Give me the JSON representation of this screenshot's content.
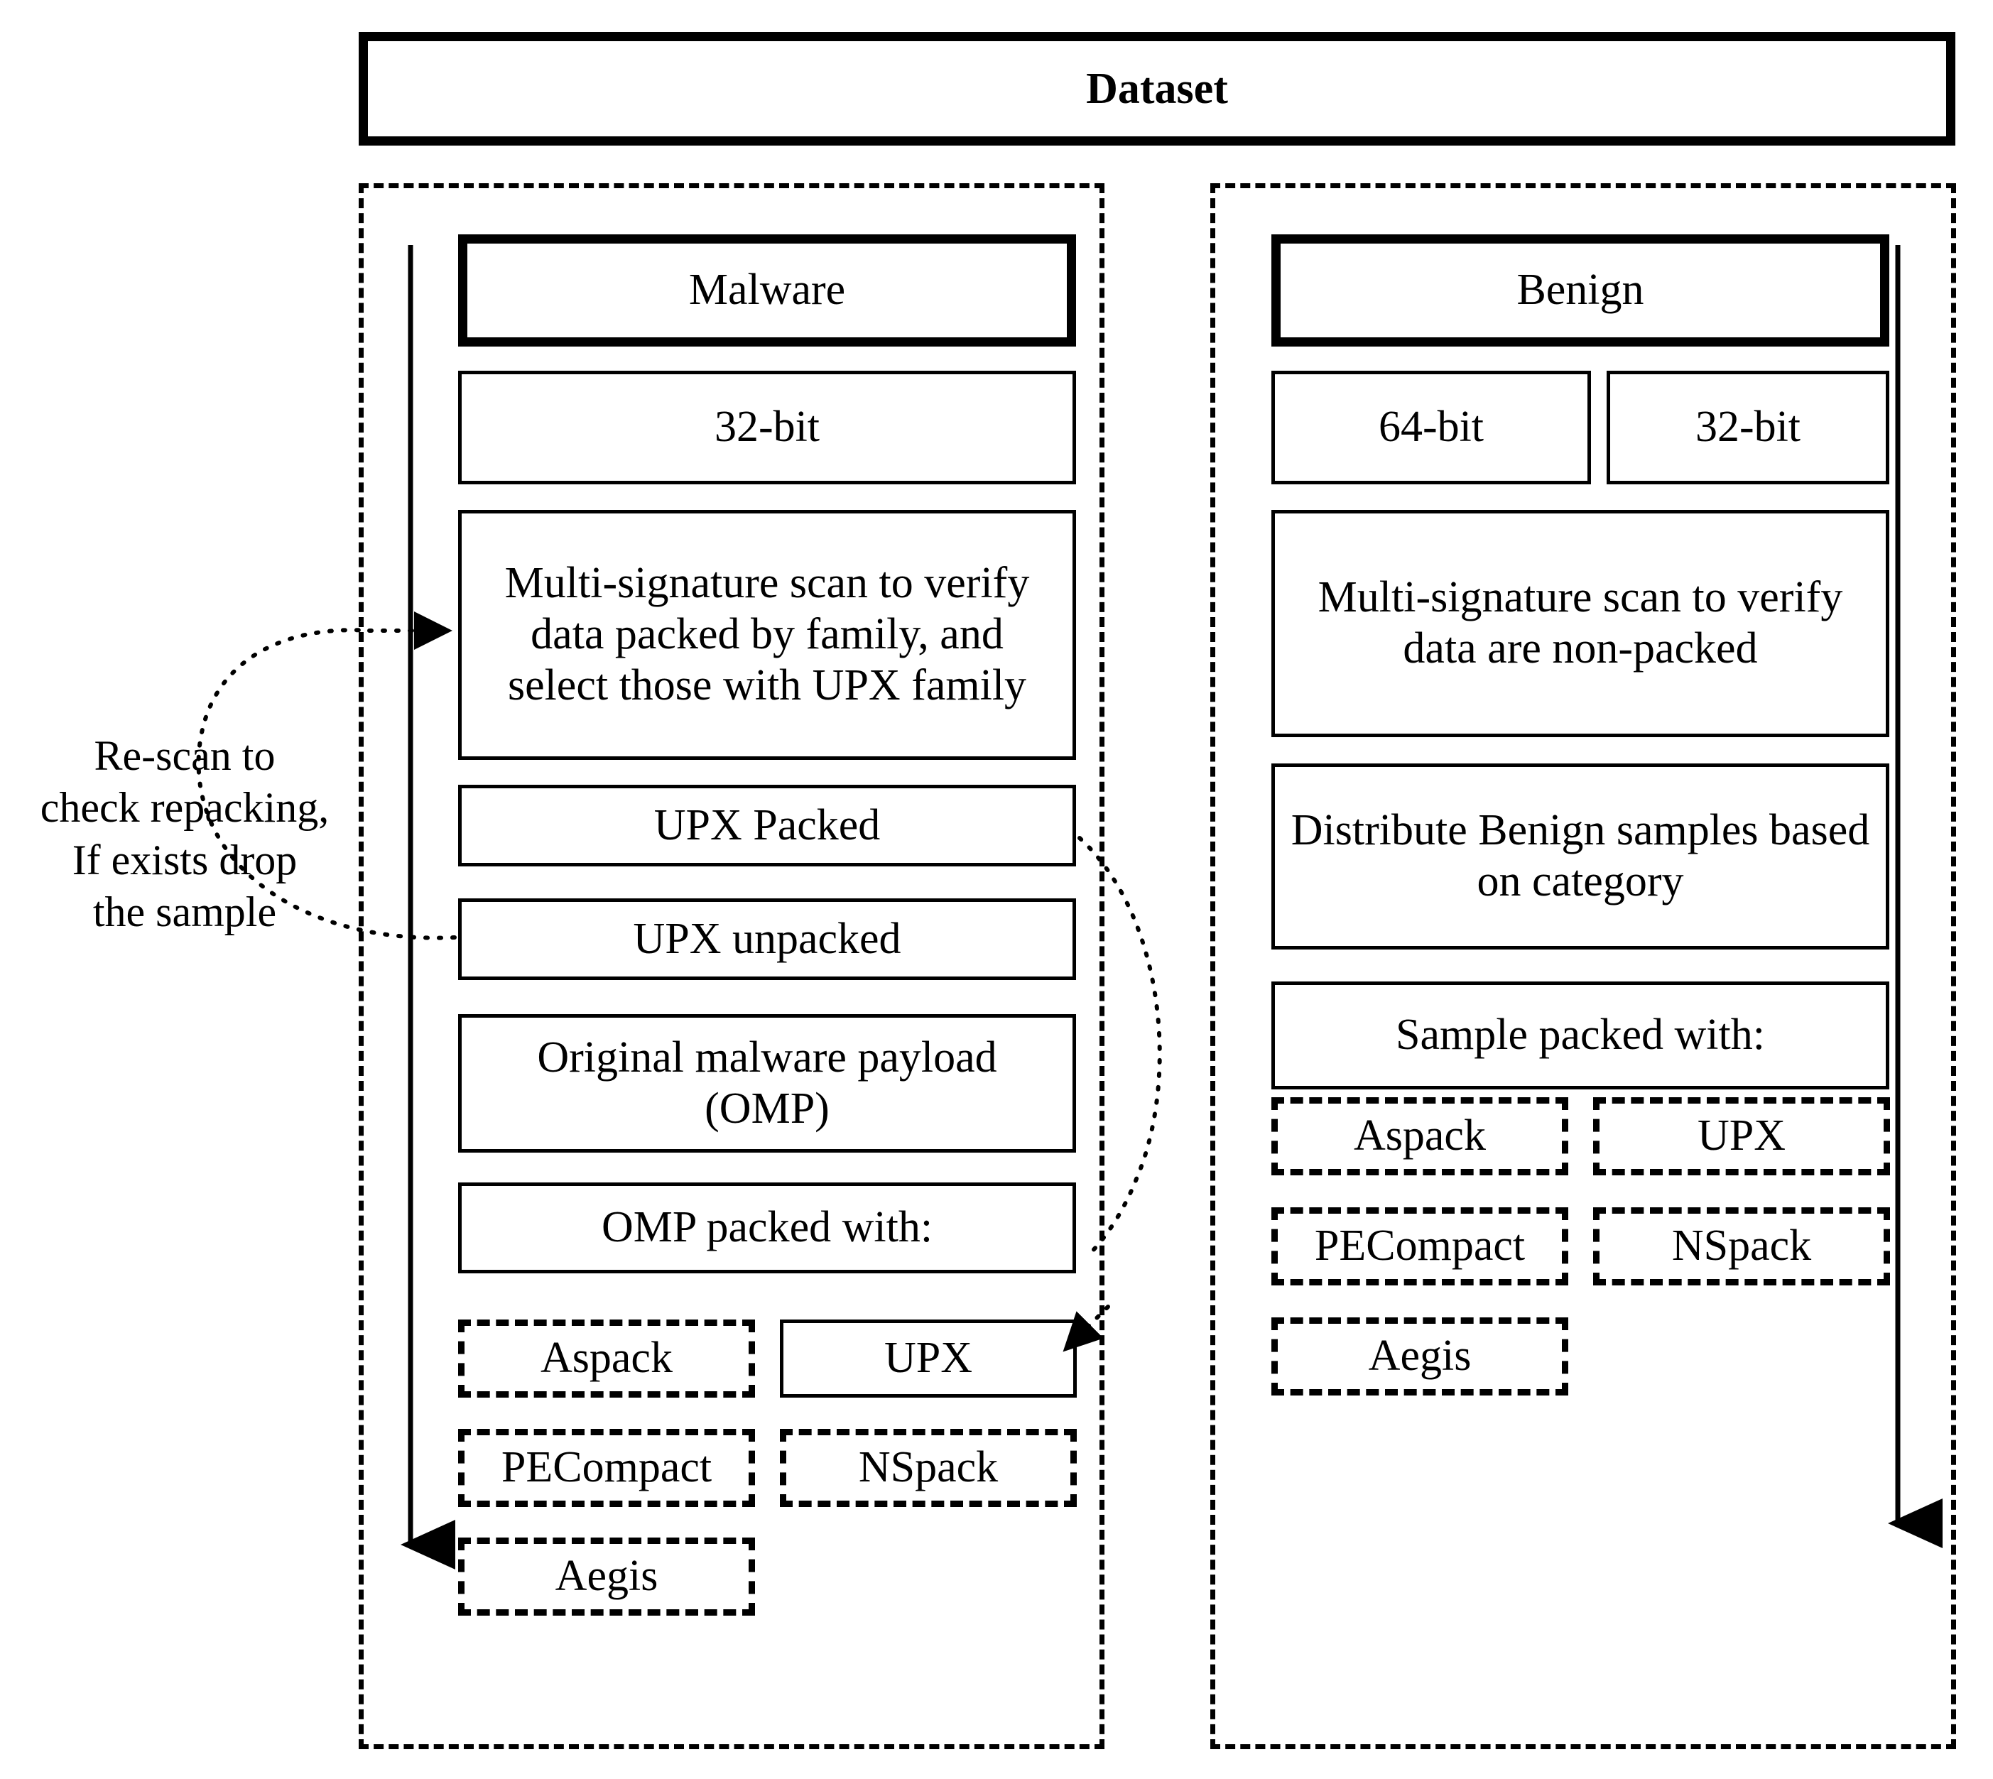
{
  "header": {
    "title": "Dataset"
  },
  "annotation": {
    "rescan_note": "Re-scan to\ncheck repacking,\nIf exists drop\nthe sample"
  },
  "left_panel": {
    "name": "malware-branch",
    "title": "Malware",
    "architecture": "32-bit",
    "scan_step": "Multi-signature scan to verify data packed by family, and select those with UPX family",
    "steps": [
      "UPX Packed",
      "UPX unpacked",
      "Original malware payload (OMP)",
      "OMP packed with:"
    ],
    "packers_left": [
      "Aspack",
      "PECompact",
      "Aegis"
    ],
    "packers_right": [
      "UPX",
      "NSpack"
    ]
  },
  "right_panel": {
    "name": "benign-branch",
    "title": "Benign",
    "architectures": [
      "64-bit",
      "32-bit"
    ],
    "scan_step": "Multi-signature scan to verify data are non-packed",
    "distribute_step": "Distribute Benign samples based on category",
    "pack_step": "Sample packed with:",
    "packers_left": [
      "Aspack",
      "PECompact",
      "Aegis"
    ],
    "packers_right": [
      "UPX",
      "NSpack"
    ]
  },
  "colors": {
    "line": "#000000",
    "background": "#ffffff"
  }
}
